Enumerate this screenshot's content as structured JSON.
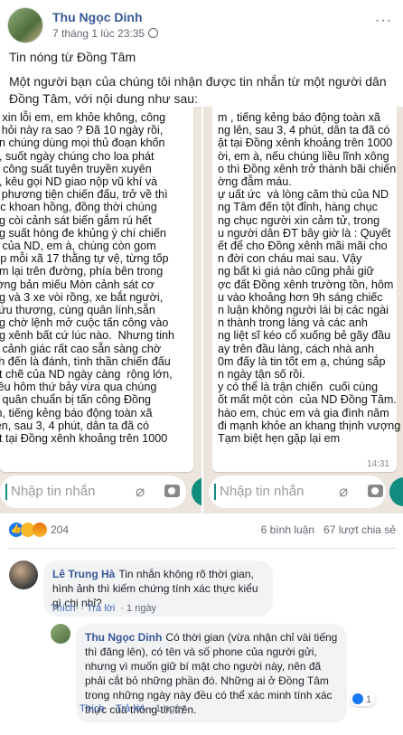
{
  "post": {
    "author": "Thu Ngọc Dinh",
    "timestamp": "7 tháng 1 lúc 23:35",
    "more_label": "···",
    "title": "Tin nóng từ Đồng Tâm",
    "body": "Một người bạn của chúng tôi nhận được tin nhắn từ một người dân Đồng Tâm, với nội dung như sau:"
  },
  "screenshot_left": {
    "text": "h xin lỗi em, em khỏe không, công\nc hỏi này ra sao ? Đã 10 ngày rồi,\nền chúng dùng mọi thủ đoạn khốn\nn, suốt ngày chúng cho loa phát\nrt công suất tuyên truyền xuyên\nn, kêu gọi ND giao nộp vũ khí và\nc phương tiện chiến đấu, trở về thì\nợc khoan hồng, đồng thời chúng\nng còi cảnh sát biến gắm rú hết\nng suất hòng đe khủng ý chí chiến\nu của ND, em à, chúng còn gom\nợp mỗi xã 17 thằng tự vệ, từng tốp\nàm lại trên đường, phía bên trong\nrờng bản miếu Mòn cảnh sát cơ\nng và 3 xe vòi rồng, xe bắt người,\ncứu thương, cùng quân lính,sẵn\nng chờ lệnh mở cuộc tấn công vào\nng xênh bất cứ lúc nào.  Nhưng tinh\nn cảnh giác rất cao sẵn sàng chờ\nch đến là đánh, tình thần chiến đấu\nát chẽ của ND ngày càng  rộng lớn,\nliều hôm thứ bảy vừa qua chúng\nn quân chuẩn bị tấn công Đồng\nm, tiếng kẻng báo động toàn xã\nlên, sau 3, 4 phút, dân ta đã có\nặt tại Đồng xênh khoảng trên 1000",
    "input_placeholder": "Nhập tin nhắn"
  },
  "screenshot_right": {
    "text": "m , tiếng kẻng báo động toàn xã\nng lên, sau 3, 4 phút, dân ta đã có\nặt tại Đồng xênh khoảng trên 1000\nời, em à, nếu chúng liều lĩnh xông\no thì Đồng xênh trở thành bãi chiến\nờng đẫm máu.\nự uất ức  và lòng căm thù của ND\nng Tâm đến tột đỉnh, hàng chục\nng chục người xin cảm tử, trong\nu người dân ĐT bây giờ là : Quyết\nết để cho Đồng xênh mãi mãi cho\nn đời con cháu mai sau. Vậy\nng bất kì giá nào cũng phải giữ\nợc đất Đồng xênh trường tồn, hôm\nu vào khoảng hơn 9h sáng chiếc\nn luận không người lái bị các ngài\nn thành trong làng và các anh\nng liệt sĩ kéo cổ xuống bẻ gãy đầu\nay trên đầu làng, cách nhà anh\n0m đấy là tin tốt em ạ, chúng sắp\nn ngày tận số rồi.\ny có thể là trận chiến  cuối cùng\nốt mất một còn  của ND Đồng Tâm.\nhào em, chúc em và gia đình năm\nđi mạnh khỏe an khang thịnh vượng\nTạm biệt hẹn gặp lại em",
    "time": "14:31",
    "input_placeholder": "Nhập tin nhắn"
  },
  "stats": {
    "reaction_count": "204",
    "comments": "6 bình luận",
    "shares": "67 lượt chia sẻ"
  },
  "comments": [
    {
      "author": "Lê Trung Hà",
      "text": "Tin nhắn không rõ thời gian, hình ảnh thì kiếm chứng tính xác thực kiểu gì chị nhỉ?",
      "like": "Thích",
      "reply": "Trả lời",
      "time": "1 ngày"
    },
    {
      "author": "Thu Ngọc Dinh",
      "text": "Có thời gian (vừa nhận chỉ vài tiếng thì đăng lên), có tên và số phone của người gửi, nhưng vì muốn giữ bí mật cho người này, nên đã phải cắt bỏ những phần đó. Những ai ở Đồng Tâm trong những ngày này đều có thể xác minh tính xác thực của thông tin trên.",
      "like": "Thích",
      "reply": "Trả lời",
      "time": "1 ngày",
      "likes_count": "1"
    }
  ]
}
